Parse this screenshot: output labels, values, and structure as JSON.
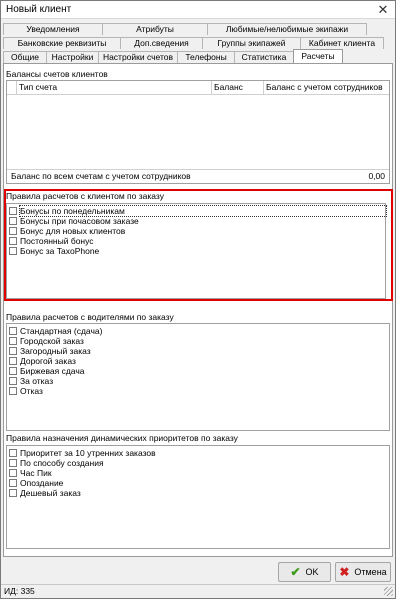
{
  "window": {
    "title": "Новый клиент"
  },
  "tabs": {
    "row1": [
      "Уведомления",
      "Атрибуты",
      "Любимые/нелюбимые экипажи"
    ],
    "row2": [
      "Банковские реквизиты",
      "Доп.сведения",
      "Группы экипажей",
      "Кабинет клиента"
    ],
    "row3": [
      "Общие",
      "Настройки",
      "Настройки счетов",
      "Телефоны",
      "Статистика",
      "Расчеты"
    ],
    "active": "Расчеты"
  },
  "balances": {
    "label": "Балансы счетов клиентов",
    "columns": [
      "Тип счета",
      "Баланс",
      "Баланс с учетом сотрудников"
    ],
    "total_label": "Баланс по всем счетам с учетом сотрудников",
    "total_value": "0,00"
  },
  "client_rules": {
    "label": "Правила расчетов с клиентом по заказу",
    "items": [
      "Бонусы по понедельникам",
      "Бонусы при почасовом заказе",
      "Бонус для новых клиентов",
      "Постоянный бонус",
      "Бонус за TaxoPhone"
    ]
  },
  "driver_rules": {
    "label": "Правила расчетов с водителями по заказу",
    "items": [
      "Стандартная (сдача)",
      "Городской заказ",
      "Загородный заказ",
      "Дорогой заказ",
      "Биржевая сдача",
      "За отказ",
      "Отказ"
    ]
  },
  "priority_rules": {
    "label": "Правила назначения динамических приоритетов по заказу",
    "items": [
      "Приоритет за 10 утренних заказов",
      "По способу создания",
      "Час Пик",
      "Опоздание",
      "Дешевый заказ"
    ]
  },
  "buttons": {
    "ok": "OK",
    "cancel": "Отмена"
  },
  "status": {
    "id_text": "ИД: 335"
  },
  "colors": {
    "highlight": "#e00000",
    "ok_icon": "#3a9a1a",
    "cancel_icon": "#d02020"
  }
}
